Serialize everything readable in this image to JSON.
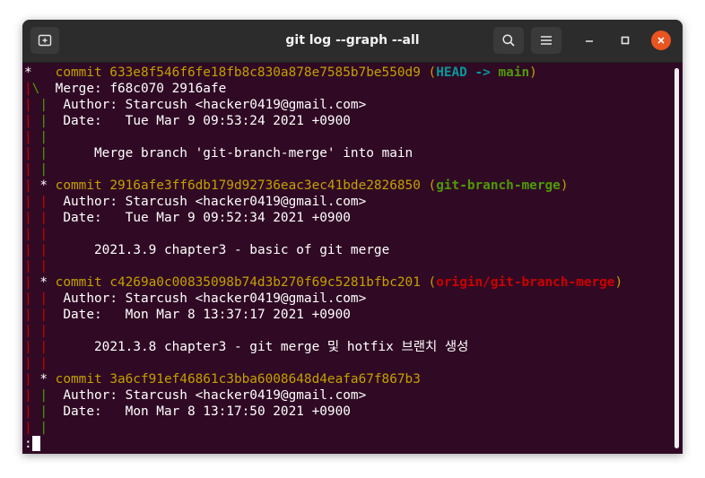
{
  "window": {
    "title": "git log --graph --all"
  },
  "icons": {
    "new_tab": "new-tab-icon",
    "search": "search-icon",
    "menu": "hamburger-menu-icon",
    "minimize": "minimize-icon",
    "maximize": "maximize-icon",
    "close": "close-icon"
  },
  "colors": {
    "background": "#300a24",
    "commit_hash": "#c4a000",
    "head": "#06989a",
    "local_branch": "#4e9a06",
    "remote_branch": "#cc0000",
    "graph_red": "#cc0000",
    "graph_green": "#4e9a06",
    "close_button": "#e95420"
  },
  "log": {
    "c1_graph": "*   ",
    "c1_commit": "commit 633e8f546f6fe18fb8c830a878e7585b7be550d9",
    "c1_ref_open": " (",
    "c1_head": "HEAD -> ",
    "c1_branch": "main",
    "c1_ref_close": ")",
    "c1_merge_g1": "|",
    "c1_merge_g2": "\\  ",
    "c1_merge": "Merge: f68c070 2916afe",
    "c1_author": "Author: Starcush <hacker0419@gmail.com>",
    "c1_date": "Date:   Tue Mar 9 09:53:24 2021 +0900",
    "c1_message": "    Merge branch 'git-branch-merge' into main",
    "c2_graph": " * ",
    "c2_commit": "commit 2916afe3ff6db179d92736eac3ec41bde2826850",
    "c2_ref_open": " (",
    "c2_branch": "git-branch-merge",
    "c2_ref_close": ")",
    "c2_author": "Author: Starcush <hacker0419@gmail.com>",
    "c2_date": "Date:   Tue Mar 9 09:52:34 2021 +0900",
    "c2_message": "    2021.3.9 chapter3 - basic of git merge",
    "c3_graph": " * ",
    "c3_commit": "commit c4269a0c00835098b74d3b270f69c5281bfbc201",
    "c3_ref_open": " (",
    "c3_branch": "origin/git-branch-merge",
    "c3_ref_close": ")",
    "c3_author": "Author: Starcush <hacker0419@gmail.com>",
    "c3_date": "Date:   Mon Mar 8 13:37:17 2021 +0900",
    "c3_message": "    2021.3.8 chapter3 - git merge 및 hotfix 브랜치 생성",
    "c4_graph": " * ",
    "c4_commit": "commit 3a6cf91ef46861c3bba6008648d4eafa67f867b3",
    "c4_author": "Author: Starcush <hacker0419@gmail.com>",
    "c4_date": "Date:   Mon Mar 8 13:17:50 2021 +0900",
    "pipe": "|",
    "pipe_gap": " ",
    "pipe_sep": " ",
    "indent": "  ",
    "prompt": ":"
  }
}
